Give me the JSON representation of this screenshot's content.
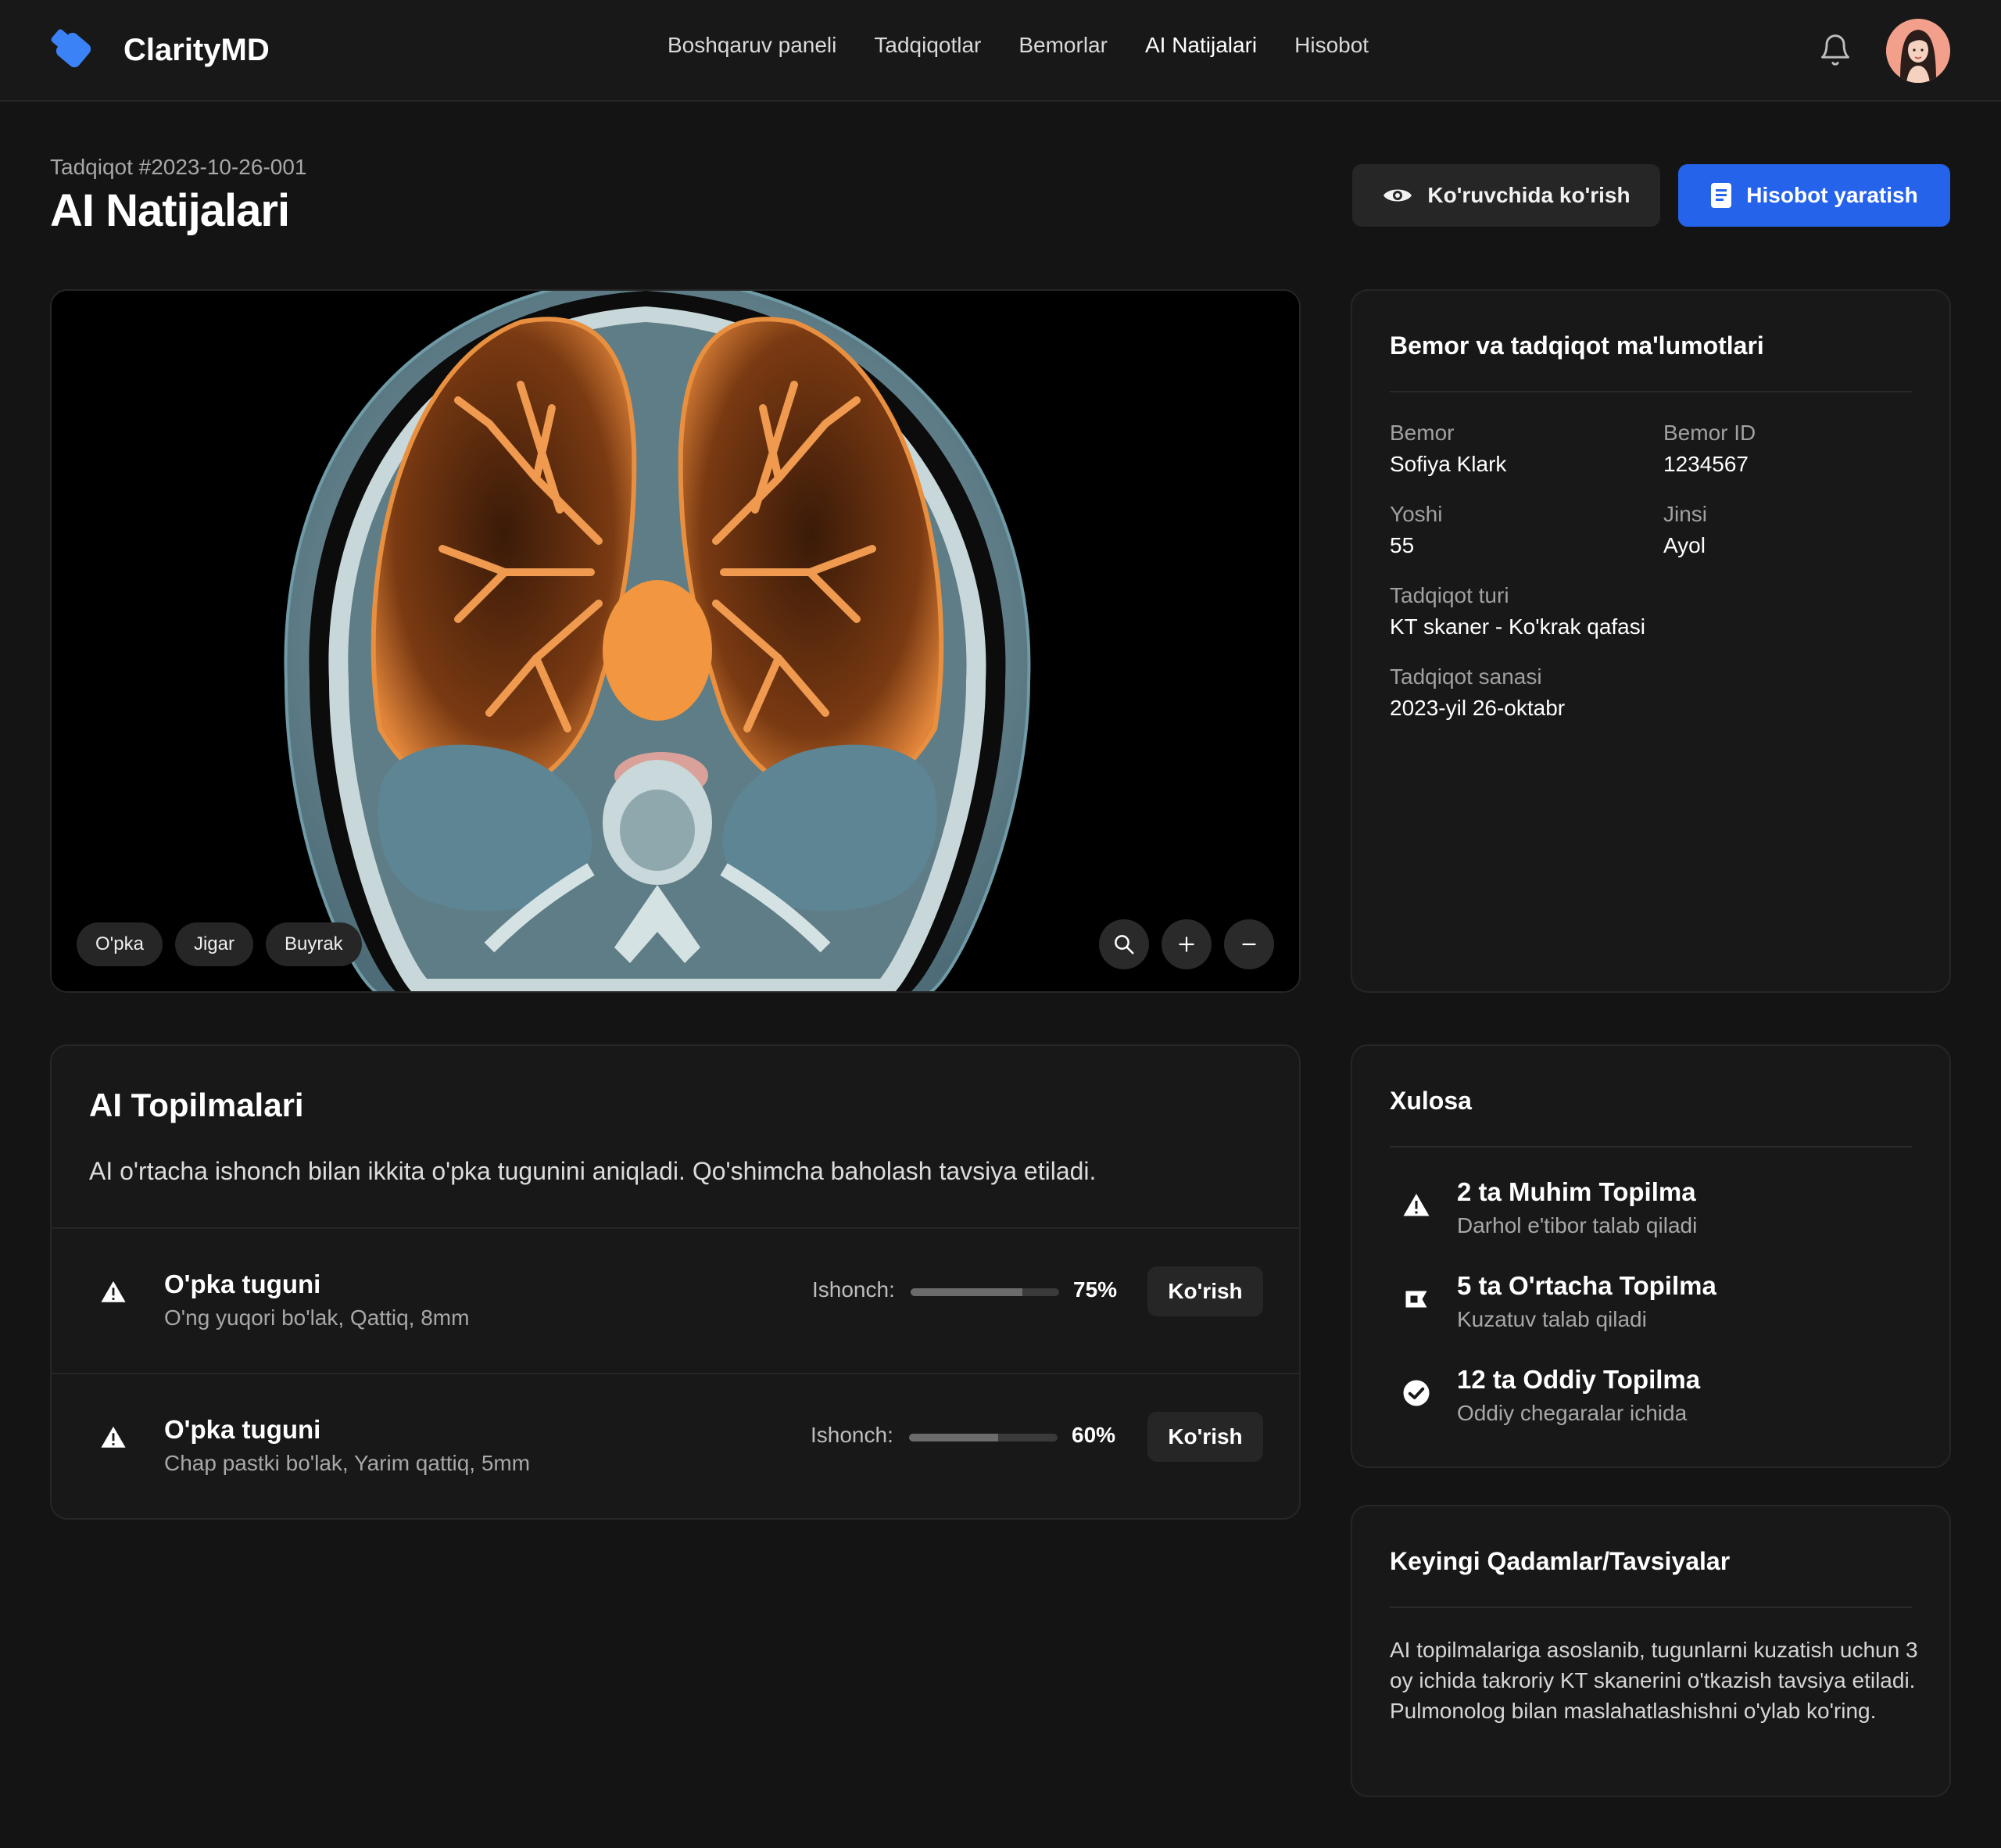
{
  "app": {
    "brand": "ClarityMD"
  },
  "nav": {
    "items": [
      "Boshqaruv paneli",
      "Tadqiqotlar",
      "Bemorlar",
      "AI Natijalari",
      "Hisobot"
    ],
    "active": "AI Natijalari"
  },
  "header": {
    "study_id": "Tadqiqot #2023-10-26-001",
    "title": "AI Natijalari",
    "view_button": "Ko'ruvchida ko'rish",
    "report_button": "Hisobot yaratish"
  },
  "viewer": {
    "chips": [
      "O'pka",
      "Jigar",
      "Buyrak"
    ],
    "tools": [
      "search-icon",
      "zoom-in-icon",
      "zoom-out-icon"
    ]
  },
  "patient": {
    "card_title": "Bemor va tadqiqot ma'lumotlari",
    "fields": [
      {
        "label": "Bemor",
        "value": "Sofiya Klark"
      },
      {
        "label": "Bemor ID",
        "value": "1234567"
      },
      {
        "label": "Yoshi",
        "value": "55"
      },
      {
        "label": "Jinsi",
        "value": "Ayol"
      },
      {
        "label": "Tadqiqot turi",
        "value": "KT skaner - Ko'krak qafasi"
      },
      {
        "label": "Tadqiqot sanasi",
        "value": "2023-yil 26-oktabr"
      }
    ]
  },
  "findings": {
    "title": "AI Topilmalari",
    "description": "AI o'rtacha ishonch bilan ikkita o'pka tugunini aniqladi. Qo'shimcha baholash tavsiya etiladi.",
    "confidence_label": "Ishonch:",
    "view_label": "Ko'rish",
    "items": [
      {
        "name": "O'pka tuguni",
        "detail": "O'ng yuqori bo'lak, Qattiq, 8mm",
        "confidence": "75%",
        "confidence_value": 0.75
      },
      {
        "name": "O'pka tuguni",
        "detail": "Chap pastki bo'lak, Yarim qattiq, 5mm",
        "confidence": "60%",
        "confidence_value": 0.6
      }
    ]
  },
  "summary": {
    "title": "Xulosa",
    "items": [
      {
        "title": "2 ta Muhim Topilma",
        "subtitle": "Darhol e'tibor talab qiladi",
        "icon": "warning-icon"
      },
      {
        "title": "5 ta O'rtacha Topilma",
        "subtitle": "Kuzatuv talab qiladi",
        "icon": "flag-icon"
      },
      {
        "title": "12 ta Oddiy Topilma",
        "subtitle": "Oddiy chegaralar ichida",
        "icon": "check-circle-icon"
      }
    ]
  },
  "next_steps": {
    "title": "Keyingi Qadamlar/Tavsiyalar",
    "text": "AI topilmalariga asoslanib, tugunlarni kuzatish uchun 3 oy ichida takroriy KT skanerini o'tkazish tavsiya etiladi. Pulmonolog bilan maslahatlashishni o'ylab ko'ring."
  },
  "colors": {
    "accent": "#2563eb",
    "background": "#141414",
    "card": "#181818",
    "scan_orange": "#e8893a"
  }
}
